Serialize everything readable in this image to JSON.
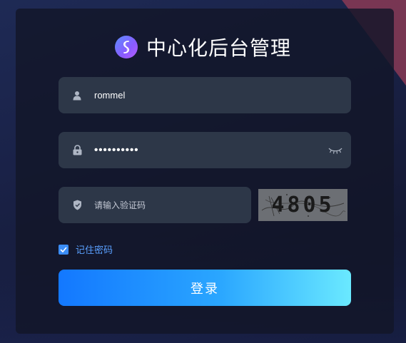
{
  "title": "中心化后台管理",
  "username": {
    "value": "rommel",
    "icon": "user-icon"
  },
  "password": {
    "value": "••••••••••",
    "icon": "lock-icon",
    "toggle_icon": "eye-closed-icon"
  },
  "captcha": {
    "placeholder": "请输入验证码",
    "icon": "shield-icon",
    "image_text": "4805"
  },
  "remember": {
    "label": "记住密码",
    "checked": true
  },
  "login_button": {
    "label": "登录"
  },
  "colors": {
    "accent": "#3b8df6",
    "button_start": "#1378ff",
    "button_end": "#6ae9ff",
    "field_bg": "#2d3748"
  }
}
